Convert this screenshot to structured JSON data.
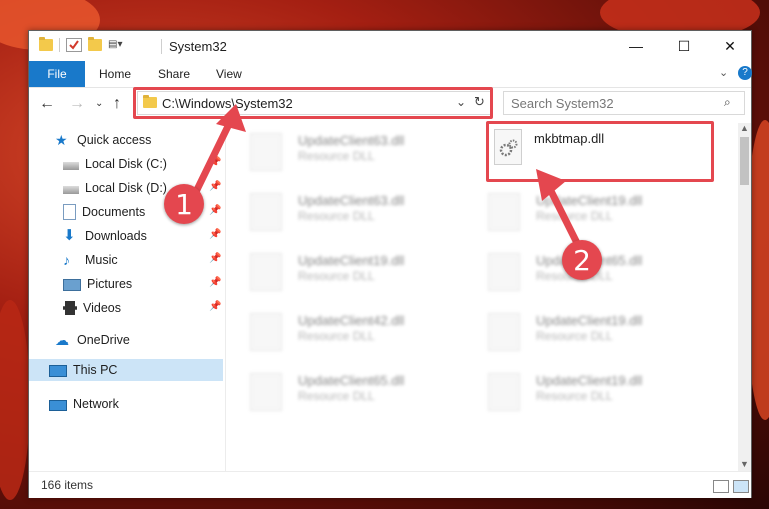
{
  "window": {
    "title": "System32",
    "buttons": {
      "minimize": "—",
      "maximize": "☐",
      "close": "✕"
    }
  },
  "ribbon": {
    "file": "File",
    "home": "Home",
    "share": "Share",
    "view": "View"
  },
  "address": {
    "path": "C:\\Windows\\System32",
    "search_placeholder": "Search System32"
  },
  "sidebar": {
    "items": [
      {
        "label": "Quick access",
        "icon": "star-icon",
        "pinned": false
      },
      {
        "label": "Local Disk (C:)",
        "icon": "drive-icon",
        "pinned": true
      },
      {
        "label": "Local Disk (D:)",
        "icon": "drive-icon",
        "pinned": true
      },
      {
        "label": "Documents",
        "icon": "document-icon",
        "pinned": true
      },
      {
        "label": "Downloads",
        "icon": "download-icon",
        "pinned": true
      },
      {
        "label": "Music",
        "icon": "music-icon",
        "pinned": true
      },
      {
        "label": "Pictures",
        "icon": "pictures-icon",
        "pinned": true
      },
      {
        "label": "Videos",
        "icon": "video-icon",
        "pinned": true
      },
      {
        "label": "OneDrive",
        "icon": "cloud-icon",
        "pinned": false
      },
      {
        "label": "This PC",
        "icon": "computer-icon",
        "pinned": false
      },
      {
        "label": "Network",
        "icon": "network-icon",
        "pinned": false
      }
    ]
  },
  "files": [
    {
      "name": "UpdateClient63.dll",
      "type": "Resource DLL"
    },
    {
      "name": "mkbtmap.dll",
      "type": ""
    },
    {
      "name": "UpdateClient63.dll",
      "type": "Resource DLL"
    },
    {
      "name": "UpdateClient19.dll",
      "type": "Resource DLL"
    },
    {
      "name": "UpdateClient19.dll",
      "type": "Resource DLL"
    },
    {
      "name": "UpdateClient65.dll",
      "type": "Resource DLL"
    },
    {
      "name": "UpdateClient42.dll",
      "type": "Resource DLL"
    },
    {
      "name": "UpdateClient19.dll",
      "type": "Resource DLL"
    },
    {
      "name": "UpdateClient65.dll",
      "type": "Resource DLL"
    },
    {
      "name": "UpdateClient19.dll",
      "type": "Resource DLL"
    }
  ],
  "status": {
    "count": "166 items"
  },
  "callouts": {
    "one": "1",
    "two": "2"
  },
  "colors": {
    "accent": "#1979ca",
    "highlight": "#e4474f",
    "selected": "#cce4f7"
  }
}
